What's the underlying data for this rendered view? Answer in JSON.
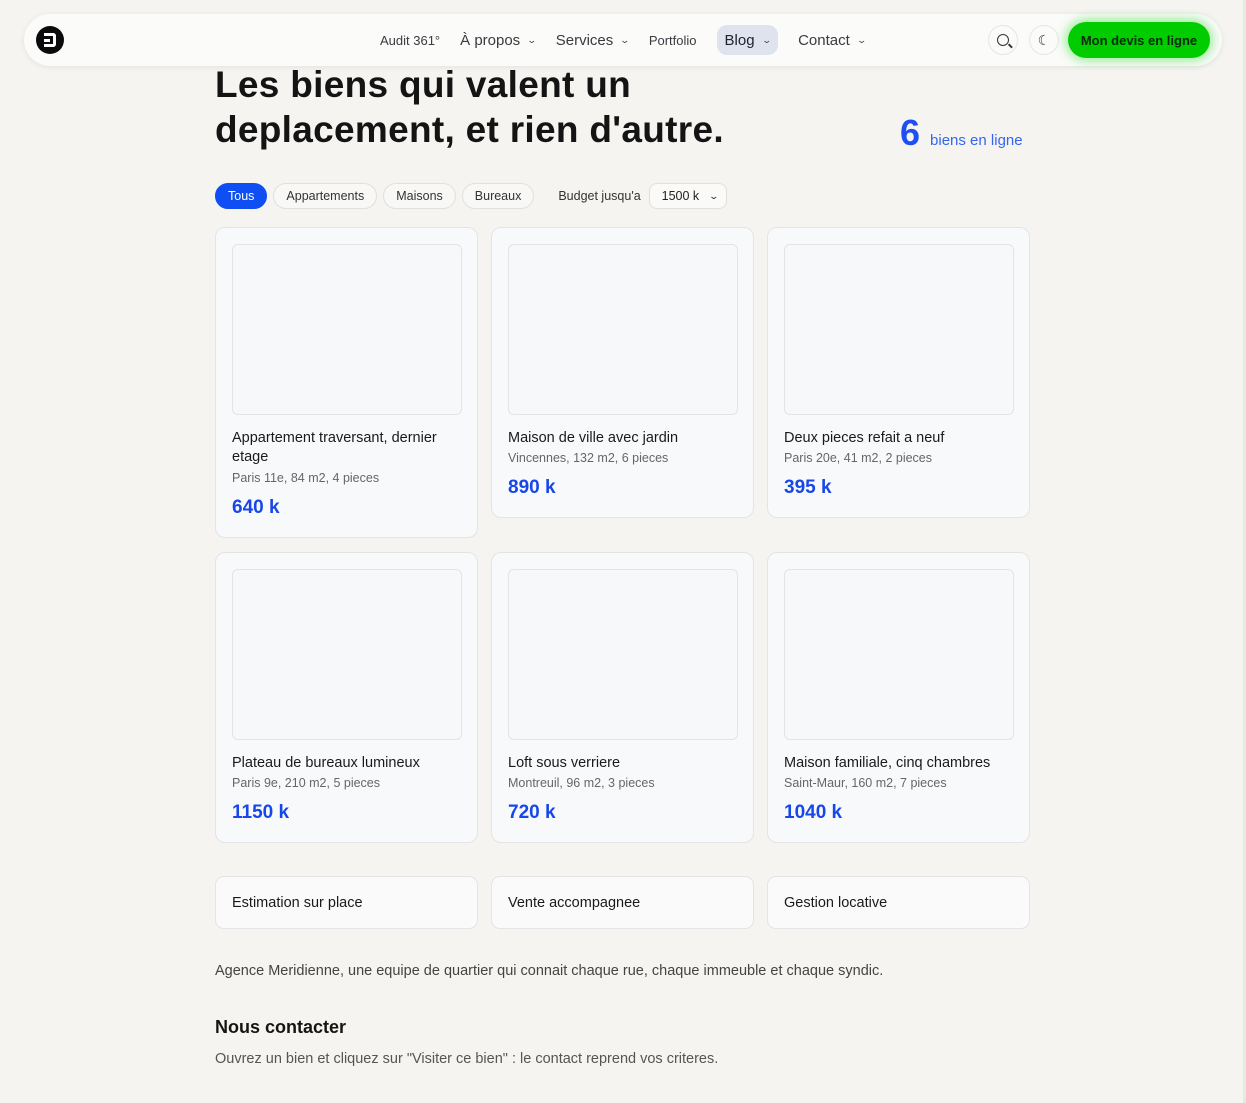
{
  "nav": {
    "items": [
      {
        "label": "Audit 361°",
        "has_menu": false
      },
      {
        "label": "À propos",
        "has_menu": true
      },
      {
        "label": "Services",
        "has_menu": true
      },
      {
        "label": "Portfolio",
        "has_menu": false
      },
      {
        "label": "Blog",
        "has_menu": true,
        "active": true
      },
      {
        "label": "Contact",
        "has_menu": true
      }
    ],
    "chevron": "⌄",
    "search_icon": "search-icon",
    "theme_icon": "moon-icon",
    "theme_glyph": "☾",
    "cta_label": "Mon devis en ligne",
    "cta_color": "#00cc00"
  },
  "hero": {
    "title_line1": "Les biens qui valent un",
    "title_line2": "deplacement, et rien d'autre.",
    "count": "6",
    "count_label": "biens en ligne",
    "accent": "#1d4ff2"
  },
  "filters": {
    "chips": [
      "Tous",
      "Appartements",
      "Maisons",
      "Bureaux"
    ],
    "active": "Tous",
    "budget_label": "Budget jusqu'a",
    "budget_value": "1500 k"
  },
  "listings": [
    {
      "title": "Appartement traversant, dernier etage",
      "meta": "Paris 11e, 84 m2, 4 pieces",
      "price": "640 k"
    },
    {
      "title": "Maison de ville avec jardin",
      "meta": "Vincennes, 132 m2, 6 pieces",
      "price": "890 k"
    },
    {
      "title": "Deux pieces refait a neuf",
      "meta": "Paris 20e, 41 m2, 2 pieces",
      "price": "395 k"
    },
    {
      "title": "Plateau de bureaux lumineux",
      "meta": "Paris 9e, 210 m2, 5 pieces",
      "price": "1150 k"
    },
    {
      "title": "Loft sous verriere",
      "meta": "Montreuil, 96 m2, 3 pieces",
      "price": "720 k"
    },
    {
      "title": "Maison familiale, cinq chambres",
      "meta": "Saint-Maur, 160 m2, 7 pieces",
      "price": "1040 k"
    }
  ],
  "services": [
    "Estimation sur place",
    "Vente accompagnee",
    "Gestion locative"
  ],
  "about": "Agence Meridienne, une equipe de quartier qui connait chaque rue, chaque immeuble et chaque syndic.",
  "contact": {
    "title": "Nous contacter",
    "text": "Ouvrez un bien et cliquez sur \"Visiter ce bien\" : le contact reprend vos criteres."
  }
}
